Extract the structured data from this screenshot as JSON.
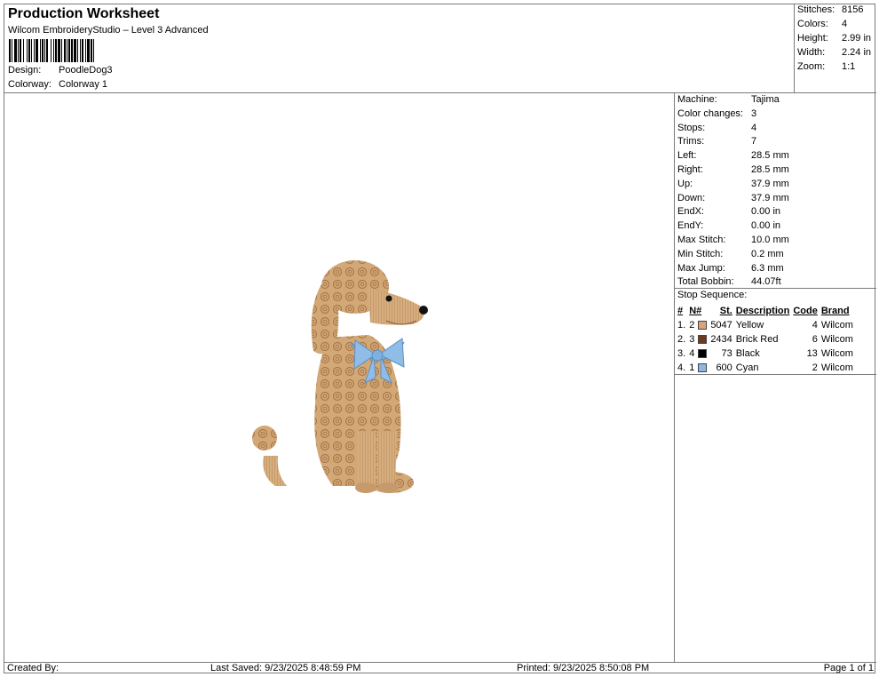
{
  "header": {
    "title": "Production Worksheet",
    "subtitle": "Wilcom EmbroideryStudio – Level 3 Advanced",
    "design_label": "Design:",
    "design_value": "PoodleDog3",
    "colorway_label": "Colorway:",
    "colorway_value": "Colorway 1"
  },
  "summary": [
    {
      "label": "Stitches:",
      "value": "8156"
    },
    {
      "label": "Colors:",
      "value": "4"
    },
    {
      "label": "Height:",
      "value": "2.99 in"
    },
    {
      "label": "Width:",
      "value": "2.24 in"
    },
    {
      "label": "Zoom:",
      "value": "1:1"
    }
  ],
  "info": [
    {
      "label": "Machine:",
      "value": "Tajima"
    },
    {
      "label": "Color changes:",
      "value": "3"
    },
    {
      "label": "Stops:",
      "value": "4"
    },
    {
      "label": "Trims:",
      "value": "7"
    },
    {
      "label": "Left:",
      "value": "28.5 mm"
    },
    {
      "label": "Right:",
      "value": "28.5 mm"
    },
    {
      "label": "Up:",
      "value": "37.9 mm"
    },
    {
      "label": "Down:",
      "value": "37.9 mm"
    },
    {
      "label": "EndX:",
      "value": "0.00 in"
    },
    {
      "label": "EndY:",
      "value": "0.00 in"
    },
    {
      "label": "Max Stitch:",
      "value": "10.0 mm"
    },
    {
      "label": "Min Stitch:",
      "value": "0.2 mm"
    },
    {
      "label": "Max Jump:",
      "value": "6.3 mm"
    },
    {
      "label": "Total Bobbin:",
      "value": "44.07ft"
    }
  ],
  "stops": {
    "title": "Stop Sequence:",
    "headers": {
      "num": "#",
      "n": "N#",
      "st": "St.",
      "desc": "Description",
      "code": "Code",
      "brand": "Brand"
    },
    "rows": [
      {
        "num": "1.",
        "n": "2",
        "color": "#d9a27e",
        "st": "5047",
        "desc": "Yellow",
        "code": "4",
        "brand": "Wilcom"
      },
      {
        "num": "2.",
        "n": "3",
        "color": "#6b3a1f",
        "st": "2434",
        "desc": "Brick Red",
        "code": "6",
        "brand": "Wilcom"
      },
      {
        "num": "3.",
        "n": "4",
        "color": "#000000",
        "st": "73",
        "desc": "Black",
        "code": "13",
        "brand": "Wilcom"
      },
      {
        "num": "4.",
        "n": "1",
        "color": "#8ab8e8",
        "st": "600",
        "desc": "Cyan",
        "code": "2",
        "brand": "Wilcom"
      }
    ]
  },
  "footer": {
    "created": "Created By:",
    "last_saved": "Last Saved: 9/23/2025 8:48:59 PM",
    "printed": "Printed: 9/23/2025 8:50:08 PM",
    "page": "Page 1 of 1"
  },
  "design_colors": {
    "fur": "#d3a877",
    "fur_dark": "#a9784a",
    "bow": "#8fbde8",
    "nose": "#111111"
  }
}
